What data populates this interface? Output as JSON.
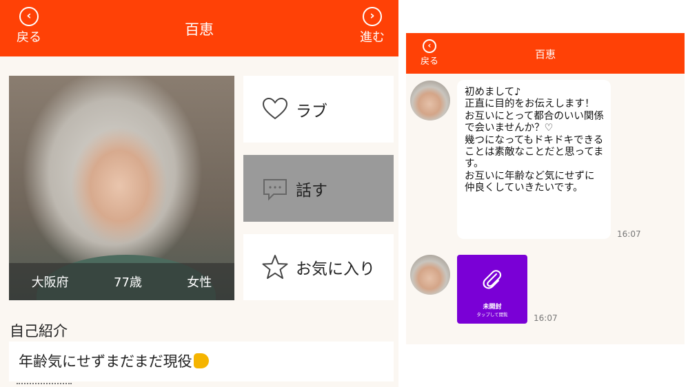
{
  "profile": {
    "header": {
      "back_label": "戻る",
      "title": "百恵",
      "forward_label": "進む"
    },
    "info": {
      "location": "大阪府",
      "age": "77歳",
      "gender": "女性"
    },
    "actions": {
      "love": "ラブ",
      "talk": "話す",
      "favorite": "お気に入り"
    },
    "intro_heading": "自己紹介",
    "intro_text": "年齢気にせずまだまだ現役"
  },
  "chat": {
    "header": {
      "back_label": "戻る",
      "title": "百恵"
    },
    "message_text": "初めまして♪\n正直に目的をお伝えします！\nお互いにとって都合のいい関係で会いませんか？♡\n幾つになってもドキドキできることは素敵なことだと思ってます。\nお互いに年齢など気にせずに仲良くしていきたいです。",
    "message_time": "16:07",
    "attachment": {
      "label": "未開封",
      "sublabel": "タップして開覧",
      "time": "16:07"
    }
  },
  "colors": {
    "header": "#ff4106",
    "talk_button": "#9a9a9a",
    "attachment": "#7a00d6",
    "background": "#fbf7f2"
  },
  "icons": [
    "chevron-left-circle-icon",
    "chevron-right-circle-icon",
    "heart-outline-icon",
    "chat-bubble-icon",
    "star-outline-icon",
    "paperclip-icon",
    "flexed-biceps-emoji"
  ]
}
